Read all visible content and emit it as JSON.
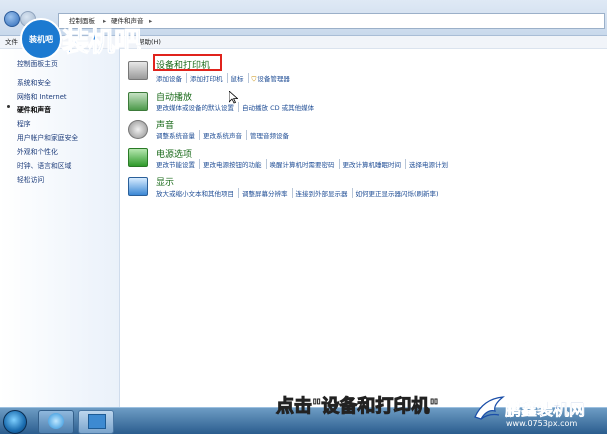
{
  "address": {
    "crumbs": [
      "控制面板",
      "硬件和声音"
    ],
    "separator": "▸"
  },
  "menu": {
    "file": "文件",
    "help": "帮助(H)"
  },
  "logo": {
    "circle_text": "装机吧",
    "wordmark": "装机吧"
  },
  "sidebar": {
    "items": [
      {
        "label": "控制面板主页"
      },
      {
        "label": "系统和安全"
      },
      {
        "label": "网络和 Internet"
      },
      {
        "label": "硬件和声音",
        "current": true
      },
      {
        "label": "程序"
      },
      {
        "label": "用户帐户和家庭安全"
      },
      {
        "label": "外观和个性化"
      },
      {
        "label": "时钟、语言和区域"
      },
      {
        "label": "轻松访问"
      }
    ]
  },
  "categories": [
    {
      "title": "设备和打印机",
      "icon": "printer-icon",
      "links": [
        "添加设备",
        "添加打印机",
        "鼠标",
        "设备管理器"
      ]
    },
    {
      "title": "自动播放",
      "icon": "autoplay-icon",
      "links": [
        "更改媒体或设备的默认设置",
        "自动播放 CD 或其他媒体"
      ]
    },
    {
      "title": "声音",
      "icon": "speaker-icon",
      "links": [
        "调整系统音量",
        "更改系统声音",
        "管理音频设备"
      ]
    },
    {
      "title": "电源选项",
      "icon": "power-icon",
      "links": [
        "更改节能设置",
        "更改电源按钮的功能",
        "唤醒计算机时需要密码",
        "更改计算机睡眠时间",
        "选择电源计划"
      ]
    },
    {
      "title": "显示",
      "icon": "display-icon",
      "links": [
        "放大或缩小文本和其他项目",
        "调整屏幕分辨率",
        "连接到外部显示器",
        "如何更正显示器闪烁(刷新率)"
      ]
    }
  ],
  "overlay": {
    "caption": "点击\"设备和打印机\"",
    "watermark": "鹏鑫装机网",
    "watermark_url": "www.0753px.com"
  },
  "colors": {
    "highlight": "#e0231c",
    "category_title": "#1a6a1a",
    "link": "#1f4d95"
  }
}
